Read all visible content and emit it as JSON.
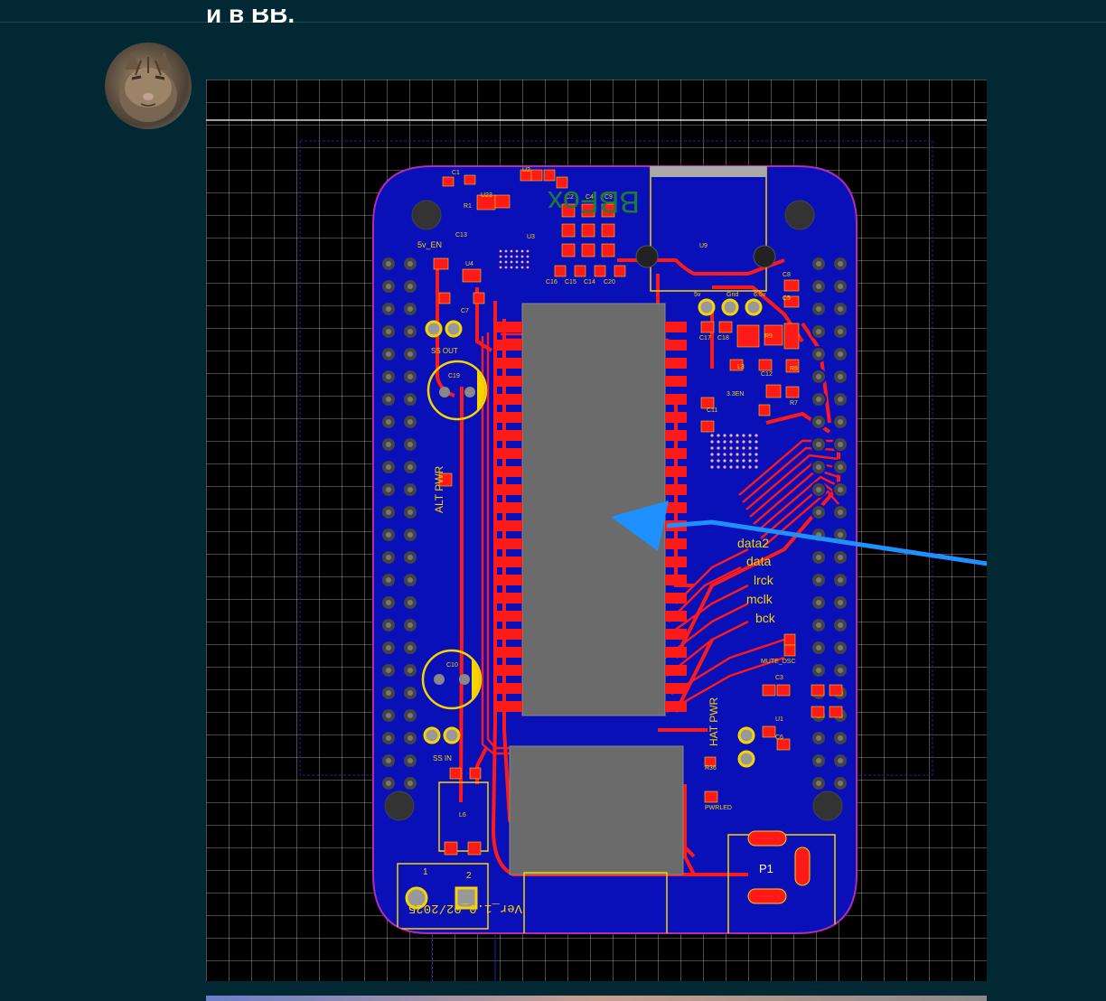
{
  "post": {
    "text": "и в ВВ."
  },
  "pcb": {
    "labels": {
      "title": "BBFox",
      "u9": "U9",
      "u2": "U2",
      "u23": "U23",
      "u3": "U3",
      "u4": "U4",
      "u1": "U1",
      "l3": "L3",
      "l6": "L6",
      "r9": "R9",
      "r8": "R8",
      "r7": "R7",
      "r1": "R1",
      "r36": "R36",
      "c1": "C1",
      "c2": "C2",
      "c4": "C4",
      "c9": "C9",
      "c13": "C13",
      "c7": "C7",
      "c16": "C16",
      "c15": "C15",
      "c14": "C14",
      "c20": "C20",
      "c8": "C8",
      "c5": "C5",
      "c17": "C17",
      "c18": "C18",
      "c12": "C12",
      "c11": "C11",
      "c19": "C19",
      "c10": "C10",
      "c3": "C3",
      "c6": "C6",
      "v5_en": "5v_EN",
      "ss_out": "SS OUT",
      "ss_in": "SS IN",
      "alt_pwr": "ALT PWR",
      "hat_pwr": "HAT PWR",
      "en33": "3.3EN",
      "v5": "5v",
      "gnd": "Gnd",
      "v65": "6.5v",
      "data2": "data2",
      "data": "data",
      "lrck": "lrck",
      "mclk": "mclk",
      "bck": "bck",
      "mute": "MUTE_DSC",
      "pwrled": "PWRLED",
      "p1": "P1",
      "version": "Ver_1.0_02/2025",
      "pin1": "1",
      "pin2": "2"
    }
  }
}
